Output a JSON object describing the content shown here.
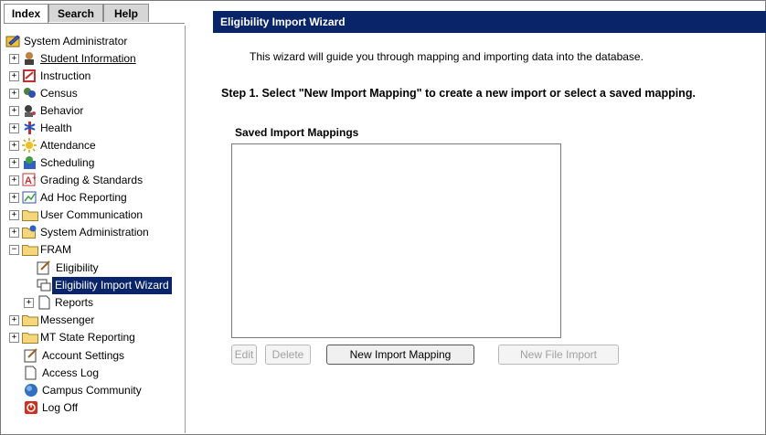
{
  "tabs": [
    {
      "label": "Index",
      "active": true
    },
    {
      "label": "Search",
      "active": false
    },
    {
      "label": "Help",
      "active": false
    }
  ],
  "tree": {
    "root": "System Administrator",
    "items": [
      {
        "label": "Student Information",
        "icon": "student-icon",
        "expander": "+"
      },
      {
        "label": "Instruction",
        "icon": "instruction-icon",
        "expander": "+"
      },
      {
        "label": "Census",
        "icon": "census-icon",
        "expander": "+"
      },
      {
        "label": "Behavior",
        "icon": "behavior-icon",
        "expander": "+"
      },
      {
        "label": "Health",
        "icon": "health-icon",
        "expander": "+"
      },
      {
        "label": "Attendance",
        "icon": "attendance-icon",
        "expander": "+"
      },
      {
        "label": "Scheduling",
        "icon": "scheduling-icon",
        "expander": "+"
      },
      {
        "label": "Grading & Standards",
        "icon": "grading-icon",
        "expander": "+"
      },
      {
        "label": "Ad Hoc Reporting",
        "icon": "adhoc-icon",
        "expander": "+"
      },
      {
        "label": "User Communication",
        "icon": "folder-icon",
        "expander": "+"
      },
      {
        "label": "System Administration",
        "icon": "sysadmin-icon",
        "expander": "+"
      },
      {
        "label": "FRAM",
        "icon": "folder-icon",
        "expander": "−"
      }
    ],
    "fram_children": [
      {
        "label": "Eligibility",
        "icon": "eligibility-icon"
      },
      {
        "label": "Eligibility Import Wizard",
        "icon": "wizard-icon",
        "selected": true
      },
      {
        "label": "Reports",
        "icon": "reports-icon",
        "expander": "+"
      }
    ],
    "bottom_items": [
      {
        "label": "Messenger",
        "icon": "folder-icon",
        "expander": "+"
      },
      {
        "label": "MT State Reporting",
        "icon": "folder-icon",
        "expander": "+"
      },
      {
        "label": "Account Settings",
        "icon": "account-settings-icon"
      },
      {
        "label": "Access Log",
        "icon": "document-icon"
      },
      {
        "label": "Campus Community",
        "icon": "campus-community-icon"
      },
      {
        "label": "Log Off",
        "icon": "log-off-icon"
      }
    ]
  },
  "main": {
    "title": "Eligibility Import Wizard",
    "intro": "This wizard will guide you through mapping and importing data into the database.",
    "step": "Step 1. Select \"New Import Mapping\" to create a new import or select a saved mapping.",
    "saved_label": "Saved Import Mappings",
    "buttons": {
      "edit": "Edit",
      "delete": "Delete",
      "new_mapping": "New Import Mapping",
      "new_file_import": "New File Import"
    }
  },
  "colors": {
    "titlebar": "#0a246a",
    "selected": "#0a246a",
    "folder": "#f4d77a"
  }
}
